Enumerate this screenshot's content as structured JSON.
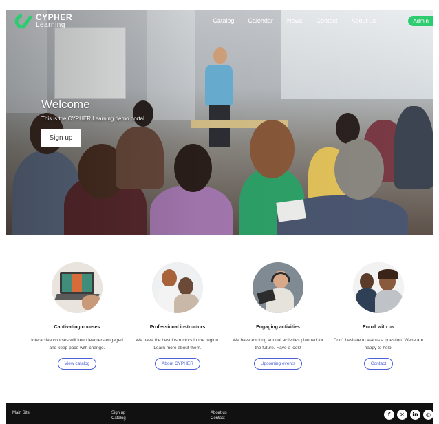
{
  "brand": {
    "name_line1": "CYPHER",
    "name_line2": "Learning",
    "color": "#2ecc71"
  },
  "nav": {
    "links": [
      "Catalog",
      "Calendar",
      "News",
      "Contact",
      "About us"
    ],
    "admin_label": "Admin"
  },
  "hero": {
    "title": "Welcome",
    "tagline": "This is the CYPHER Learning demo portal",
    "signup_label": "Sign up"
  },
  "features": [
    {
      "icon": "laptop-course-image",
      "title": "Captivating courses",
      "text": "Interactive courses will keep learners engaged and keep pace with change.",
      "button": "View catalog"
    },
    {
      "icon": "instructors-image",
      "title": "Professional instructors",
      "text": "We have the best instructors in the region. Learn more about them.",
      "button": "About CYPHER"
    },
    {
      "icon": "headphones-tablet-image",
      "title": "Engaging activities",
      "text": "We have exciting annual activities planned for the future. Have a look!",
      "button": "Upcoming events"
    },
    {
      "icon": "support-people-image",
      "title": "Enroll with us",
      "text": "Don't hesitate to ask us a question. We're are happy to help.",
      "button": "Contact"
    }
  ],
  "footer": {
    "main_site": "Main Site",
    "col2": [
      "Sign up",
      "Catalog"
    ],
    "col3": [
      "About us",
      "Contact"
    ],
    "social": [
      "facebook-icon",
      "twitter-icon",
      "linkedin-icon",
      "instagram-icon"
    ]
  },
  "colors": {
    "accent_blue": "#4a5fd8",
    "footer_bg": "#111111",
    "admin_green": "#2ecc71"
  }
}
